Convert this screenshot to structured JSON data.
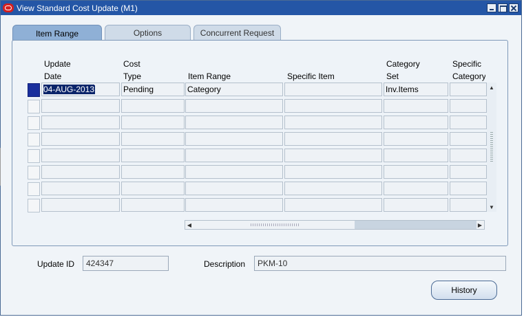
{
  "window": {
    "title": "View Standard Cost Update (M1)",
    "icon": "oracle-app-icon",
    "titlebar_color": "#2456a6"
  },
  "tabs": [
    {
      "label": "Item Range",
      "active": true
    },
    {
      "label": "Options",
      "active": false
    },
    {
      "label": "Concurrent Request",
      "active": false
    }
  ],
  "table": {
    "headers": {
      "update_date": [
        "Update",
        "Date"
      ],
      "cost_type": [
        "Cost",
        "Type"
      ],
      "item_range": "Item Range",
      "specific_item": "Specific Item",
      "category_set": [
        "Category",
        "Set"
      ],
      "specific_category": [
        "Specific",
        "Category"
      ]
    },
    "rows": [
      {
        "update_date": "04-AUG-2013",
        "cost_type": "Pending",
        "item_range": "Category",
        "specific_item": "",
        "category_set": "Inv.Items",
        "specific_category": ""
      },
      {
        "update_date": "",
        "cost_type": "",
        "item_range": "",
        "specific_item": "",
        "category_set": "",
        "specific_category": ""
      },
      {
        "update_date": "",
        "cost_type": "",
        "item_range": "",
        "specific_item": "",
        "category_set": "",
        "specific_category": ""
      },
      {
        "update_date": "",
        "cost_type": "",
        "item_range": "",
        "specific_item": "",
        "category_set": "",
        "specific_category": ""
      },
      {
        "update_date": "",
        "cost_type": "",
        "item_range": "",
        "specific_item": "",
        "category_set": "",
        "specific_category": ""
      },
      {
        "update_date": "",
        "cost_type": "",
        "item_range": "",
        "specific_item": "",
        "category_set": "",
        "specific_category": ""
      },
      {
        "update_date": "",
        "cost_type": "",
        "item_range": "",
        "specific_item": "",
        "category_set": "",
        "specific_category": ""
      },
      {
        "update_date": "",
        "cost_type": "",
        "item_range": "",
        "specific_item": "",
        "category_set": "",
        "specific_category": ""
      }
    ]
  },
  "footer": {
    "update_id_label": "Update ID",
    "update_id_value": "424347",
    "description_label": "Description",
    "description_value": "PKM-10",
    "history_button": "History"
  },
  "colors": {
    "selected_row_indicator": "#1a2f9c",
    "selection_highlight": "#0a246a",
    "active_tab": "#8fb0d6"
  }
}
